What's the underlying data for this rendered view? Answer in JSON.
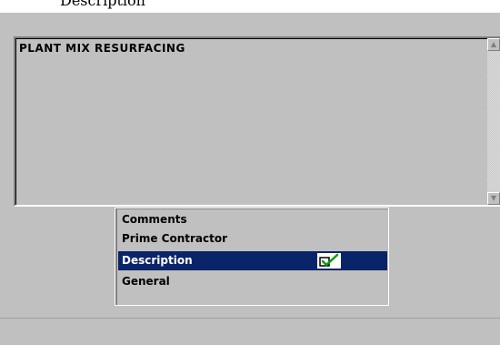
{
  "top": {
    "cutoff_text": "Description"
  },
  "description_box": {
    "text": "PLANT MIX RESURFACING"
  },
  "section_list": {
    "items": [
      {
        "label": "Comments"
      },
      {
        "label": "Prime Contractor"
      },
      {
        "label": "Description",
        "selected": true,
        "icon": "check-edit-icon"
      },
      {
        "label": "General"
      }
    ]
  },
  "colors": {
    "window_bg": "#c0c0c0",
    "selection_bg": "#0a246a",
    "selection_fg": "#ffffff",
    "check_green": "#00a000"
  }
}
